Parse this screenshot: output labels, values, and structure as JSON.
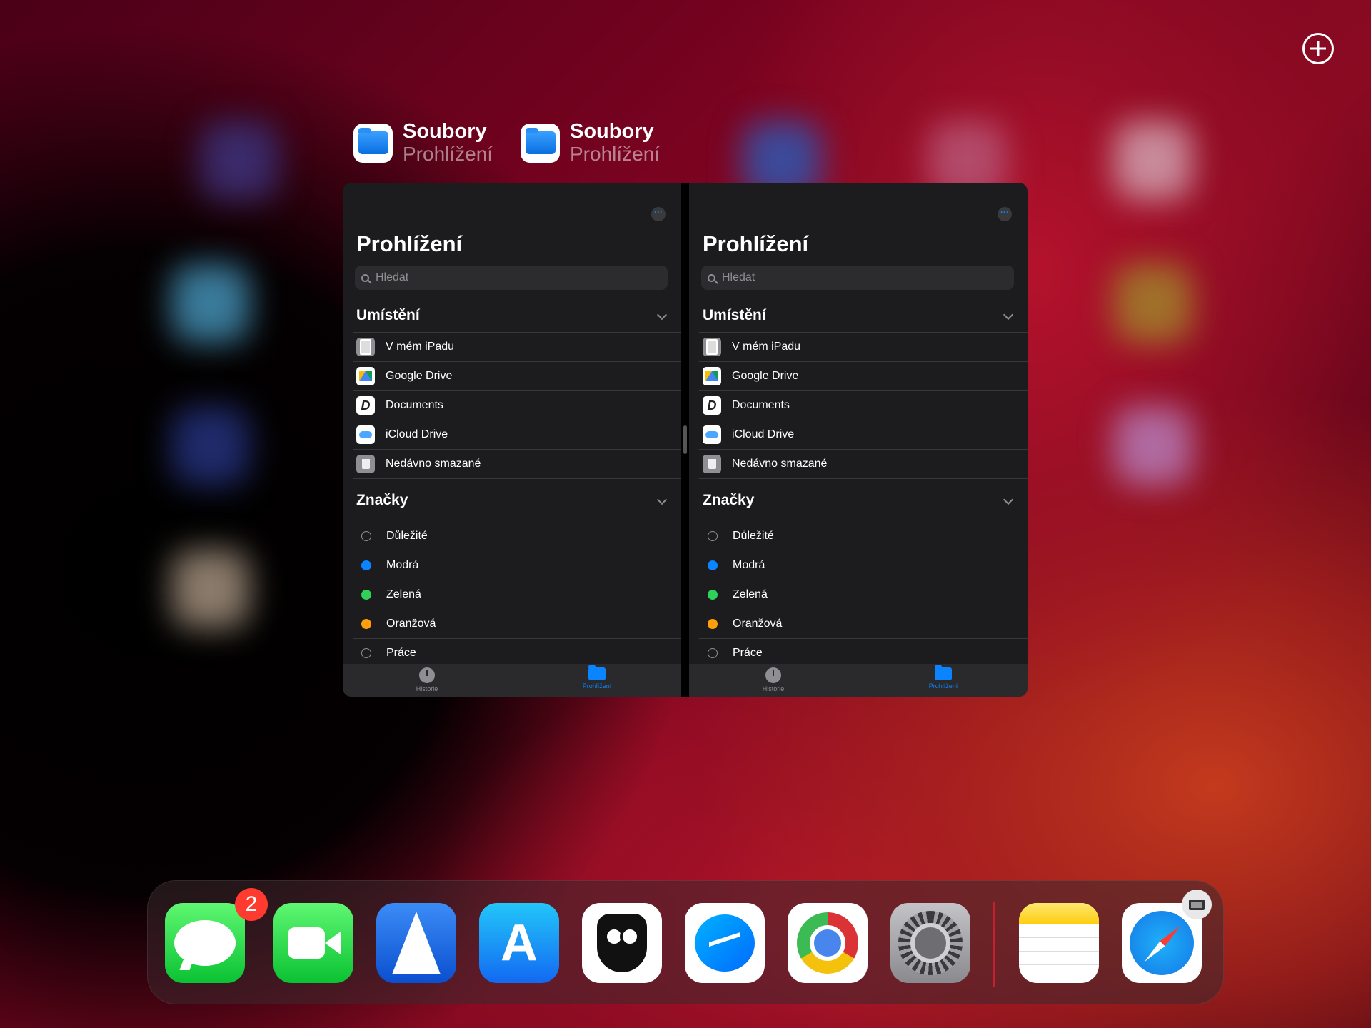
{
  "switcher_labels": [
    {
      "app": "Soubory",
      "subtitle": "Prohlížení"
    },
    {
      "app": "Soubory",
      "subtitle": "Prohlížení"
    }
  ],
  "panes": [
    {
      "title": "Prohlížení",
      "search_placeholder": "Hledat",
      "locations_header": "Umístění",
      "locations": [
        "V mém iPadu",
        "Google Drive",
        "Documents",
        "iCloud Drive",
        "Nedávno smazané"
      ],
      "tags_header": "Značky",
      "tags": [
        {
          "label": "Důležité",
          "color": ""
        },
        {
          "label": "Modrá",
          "color": "#0a84ff"
        },
        {
          "label": "Zelená",
          "color": "#30d158"
        },
        {
          "label": "Oranžová",
          "color": "#ff9f0a"
        },
        {
          "label": "Práce",
          "color": ""
        }
      ],
      "tab_history": "Historie",
      "tab_browse": "Prohlížení"
    },
    {
      "title": "Prohlížení",
      "search_placeholder": "Hledat",
      "locations_header": "Umístění",
      "locations": [
        "V mém iPadu",
        "Google Drive",
        "Documents",
        "iCloud Drive",
        "Nedávno smazané"
      ],
      "tags_header": "Značky",
      "tags": [
        {
          "label": "Důležité",
          "color": ""
        },
        {
          "label": "Modrá",
          "color": "#0a84ff"
        },
        {
          "label": "Zelená",
          "color": "#30d158"
        },
        {
          "label": "Oranžová",
          "color": "#ff9f0a"
        },
        {
          "label": "Práce",
          "color": ""
        }
      ],
      "tab_history": "Historie",
      "tab_browse": "Prohlížení"
    }
  ],
  "dock": {
    "messages_badge": "2",
    "apps": [
      "messages-icon",
      "facetime-icon",
      "spark-icon",
      "app-store-icon",
      "hootsuite-icon",
      "messenger-icon",
      "chrome-icon",
      "settings-icon",
      "notes-icon",
      "safari-icon"
    ],
    "store_glyph": "A",
    "docs_glyph": "D"
  }
}
